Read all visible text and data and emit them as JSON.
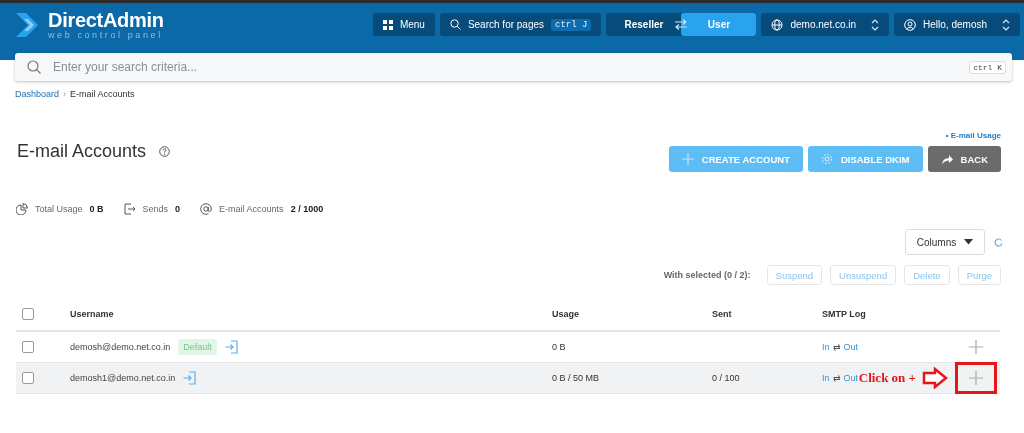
{
  "header": {
    "logo": {
      "title": "DirectAdmin",
      "subtitle": "web control panel"
    },
    "menu_button": "Menu",
    "page_search": {
      "label": "Search for pages",
      "shortcut": "ctrl J"
    },
    "role_switch": [
      {
        "label": "Reseller",
        "selected": false
      },
      {
        "label": "User",
        "selected": true
      }
    ],
    "domain": "demo.net.co.in",
    "user": "Hello, demosh"
  },
  "search": {
    "placeholder": "Enter your search criteria...",
    "shortcut": "ctrl K"
  },
  "breadcrumb": [
    "Dashboard",
    "E-mail Accounts"
  ],
  "breadcrumb_separator": "›",
  "title": "E-mail Accounts",
  "usage_link": "• E-mail Usage",
  "actions": [
    {
      "label": "CREATE ACCOUNT",
      "kind": "create"
    },
    {
      "label": "DISABLE DKIM",
      "kind": "dkim"
    },
    {
      "label": "BACK",
      "kind": "back"
    }
  ],
  "stats": [
    {
      "label": "Total Usage",
      "value": "0 B",
      "kind": "usage"
    },
    {
      "label": "Sends",
      "value": "0",
      "kind": "sends"
    },
    {
      "label": "E-mail Accounts",
      "value": "2 / 1000",
      "kind": "accounts"
    }
  ],
  "columns_button": "Columns",
  "bulk": {
    "label": "With selected (0 / 2):",
    "actions": [
      {
        "label": "Suspend",
        "disabled": true
      },
      {
        "label": "Unsuspend",
        "disabled": true
      },
      {
        "label": "Delete",
        "disabled": true
      },
      {
        "label": "Purge",
        "disabled": true
      }
    ]
  },
  "table": {
    "select_all": {
      "checked": false
    },
    "columns": [
      "Username",
      "Usage",
      "Sent",
      "SMTP Log"
    ],
    "rows": [
      {
        "checked": false,
        "hovered": false,
        "username": "demosh@demo.net.co.in",
        "badge": "Default",
        "usage": "0 B",
        "sent": "",
        "smtp": [
          "In",
          "⇄",
          "Out"
        ]
      },
      {
        "checked": false,
        "hovered": true,
        "username": "demosh1@demo.net.co.in",
        "usage": "0 B / 50 MB",
        "sent": "0 / 100",
        "smtp": [
          "In",
          "⇄",
          "Out"
        ],
        "annotation": "Click on +"
      }
    ]
  }
}
